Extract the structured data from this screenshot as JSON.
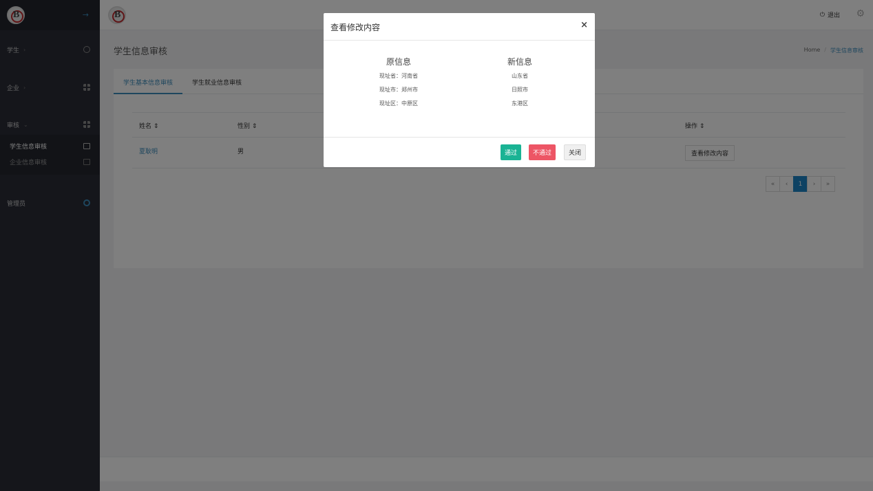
{
  "sidebar": {
    "logo": "B",
    "toggle_icon": "arrow-right-icon",
    "items": [
      {
        "label": "学生",
        "icon": "dashboard-icon"
      },
      {
        "label": "企业",
        "icon": "grid-icon"
      },
      {
        "label": "审核",
        "icon": "grid-icon"
      },
      {
        "label": "管理员",
        "icon": "ring-icon"
      }
    ],
    "submenu": [
      {
        "label": "学生信息审核",
        "icon": "calendar-icon",
        "active": true
      },
      {
        "label": "企业信息审核",
        "icon": "chat-icon",
        "active": false
      }
    ]
  },
  "topbar": {
    "logout_label": "退出",
    "logout_icon": "power-icon",
    "settings_icon": "gear-icon"
  },
  "page": {
    "title": "学生信息审核",
    "breadcrumb": [
      "Home",
      "学生信息审核"
    ]
  },
  "tabs": [
    "学生基本信息审核",
    "学生就业信息审核"
  ],
  "table": {
    "columns": [
      "姓名",
      "性别",
      "操作"
    ],
    "rows": [
      {
        "name": "夏耿明",
        "gender": "男",
        "action": "查看修改内容"
      }
    ]
  },
  "pagination": {
    "first": "«",
    "prev": "‹",
    "current": "1",
    "next": "›",
    "last": "»"
  },
  "modal": {
    "title": "查看修改内容",
    "close_glyph": "×",
    "old_header": "原信息",
    "new_header": "新信息",
    "old_lines": [
      "现址省：河南省",
      "现址市：郑州市",
      "现址区：中原区"
    ],
    "new_lines": [
      "山东省",
      "日照市",
      "东港区"
    ],
    "buttons": {
      "pass": "通过",
      "reject": "不通过",
      "close": "关闭"
    }
  },
  "colors": {
    "accent": "#3c8dbc",
    "success": "#1ab394",
    "danger": "#ed5565",
    "sidebar_bg": "#2a2c37"
  }
}
